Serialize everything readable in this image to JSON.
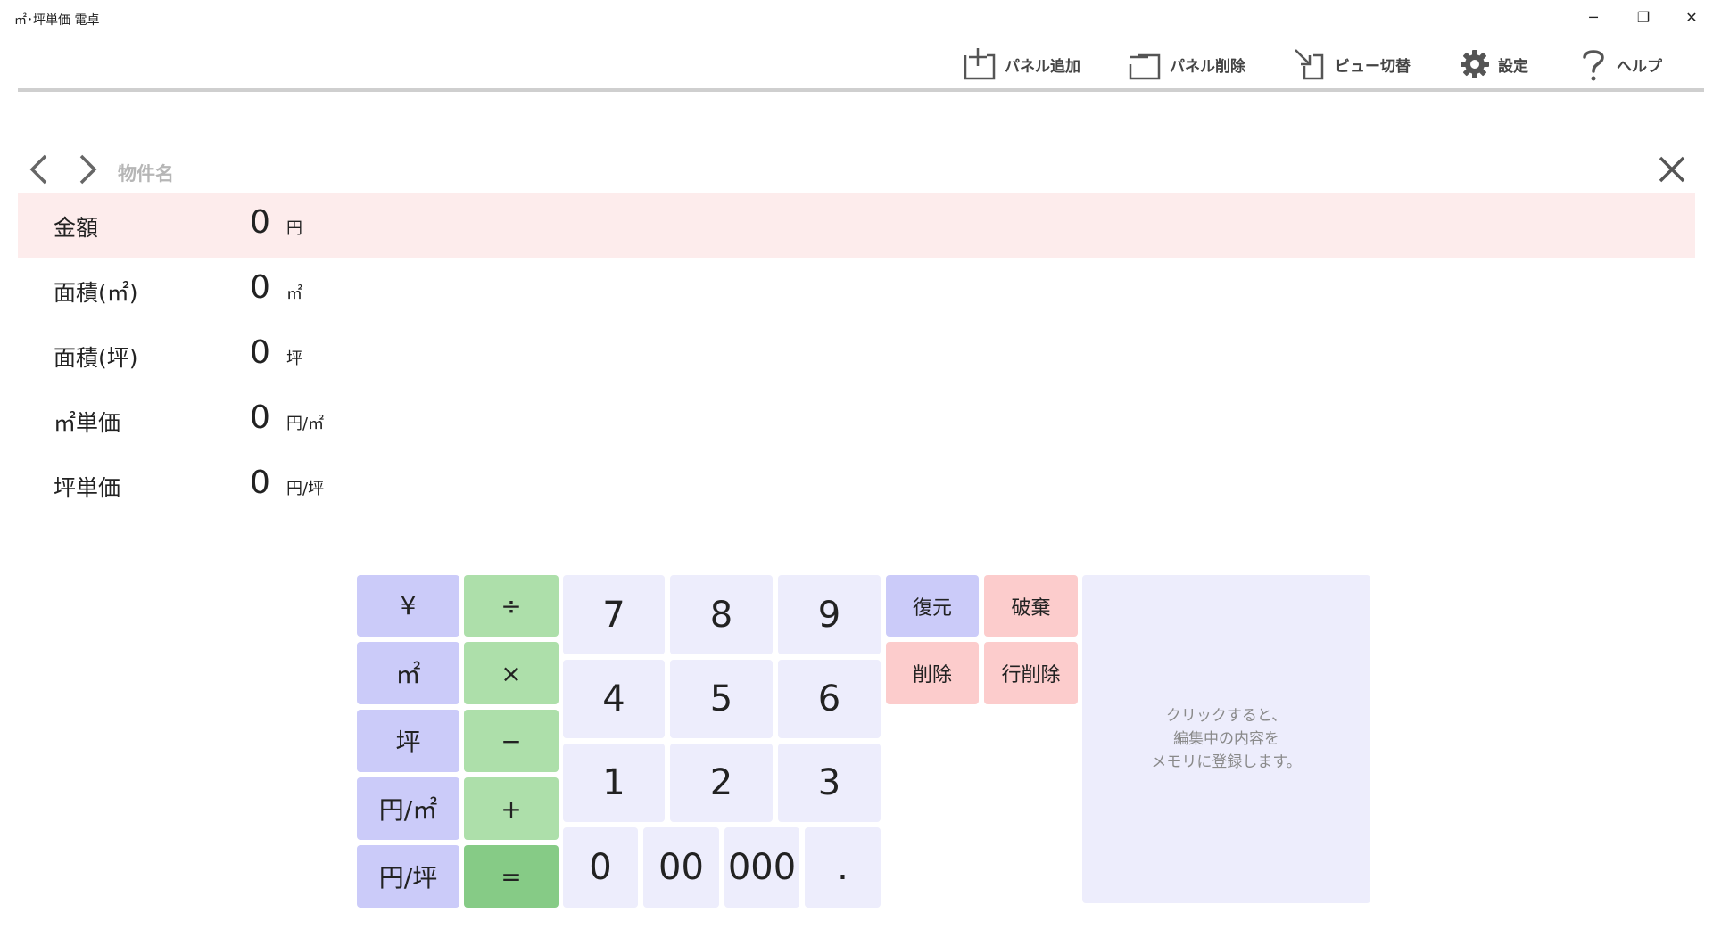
{
  "window": {
    "title": "㎡･坪単価 電卓",
    "minimize": "─",
    "maximize": "❐",
    "close": "✕"
  },
  "toolbar": {
    "add_panel": "パネル追加",
    "delete_panel": "パネル削除",
    "switch_view": "ビュー切替",
    "settings": "設定",
    "help": "ヘルプ"
  },
  "panel": {
    "name_placeholder": "物件名",
    "rows": [
      {
        "label": "金額",
        "value": "0",
        "unit": "円"
      },
      {
        "label": "面積(㎡)",
        "value": "0",
        "unit": "㎡"
      },
      {
        "label": "面積(坪)",
        "value": "0",
        "unit": "坪"
      },
      {
        "label": "㎡単価",
        "value": "0",
        "unit": "円/㎡"
      },
      {
        "label": "坪単価",
        "value": "0",
        "unit": "円/坪"
      }
    ]
  },
  "keypad": {
    "units": [
      "¥",
      "㎡",
      "坪",
      "円/㎡",
      "円/坪"
    ],
    "ops": [
      "÷",
      "×",
      "−",
      "+",
      "="
    ],
    "digits_row1": [
      "7",
      "8",
      "9"
    ],
    "digits_row2": [
      "4",
      "5",
      "6"
    ],
    "digits_row3": [
      "1",
      "2",
      "3"
    ],
    "digits_row4": [
      "0",
      "00",
      "000",
      "."
    ],
    "restore": "復元",
    "discard": "破棄",
    "delete": "削除",
    "delete_row": "行削除",
    "memory_hint": [
      "クリックすると、",
      "編集中の内容を",
      "メモリに登録します。"
    ]
  },
  "colors": {
    "unit_key": "#cbcbf9",
    "op_key": "#addfaa",
    "equals_key": "#86cb86",
    "digit_key": "#ededfc",
    "danger_key": "#fccccc",
    "active_row": "#fdecec"
  }
}
